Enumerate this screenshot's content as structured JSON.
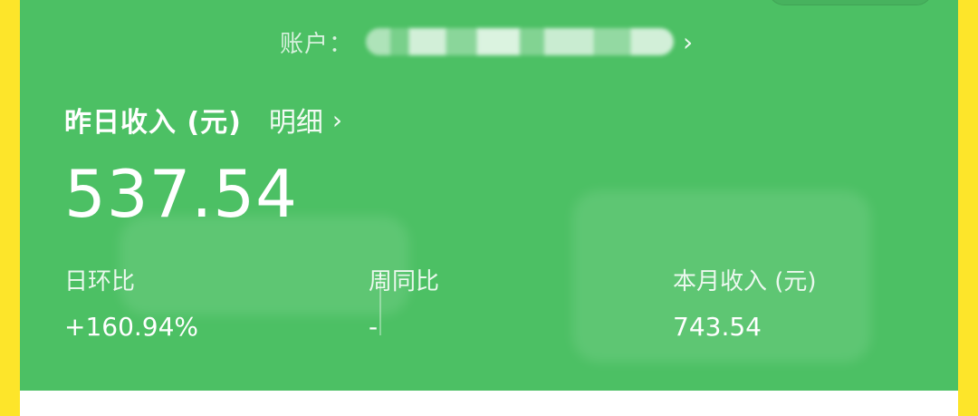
{
  "header": {
    "account_label": "账户：",
    "chevron_right": "›"
  },
  "income": {
    "title": "昨日收入 (元)",
    "detail_label": "明细",
    "amount": "537.54"
  },
  "stats": [
    {
      "label": "日环比",
      "value": "+160.94%"
    },
    {
      "label": "周同比",
      "value": "-"
    },
    {
      "label": "本月收入 (元)",
      "value": "743.54"
    }
  ],
  "colors": {
    "frame": "#fde52a",
    "card": "#4cc064",
    "text": "#ffffff",
    "bottom_panel": "#ffffff"
  },
  "icons": {
    "account_arrow": "chevron-right-icon",
    "detail_arrow": "chevron-right-icon"
  }
}
